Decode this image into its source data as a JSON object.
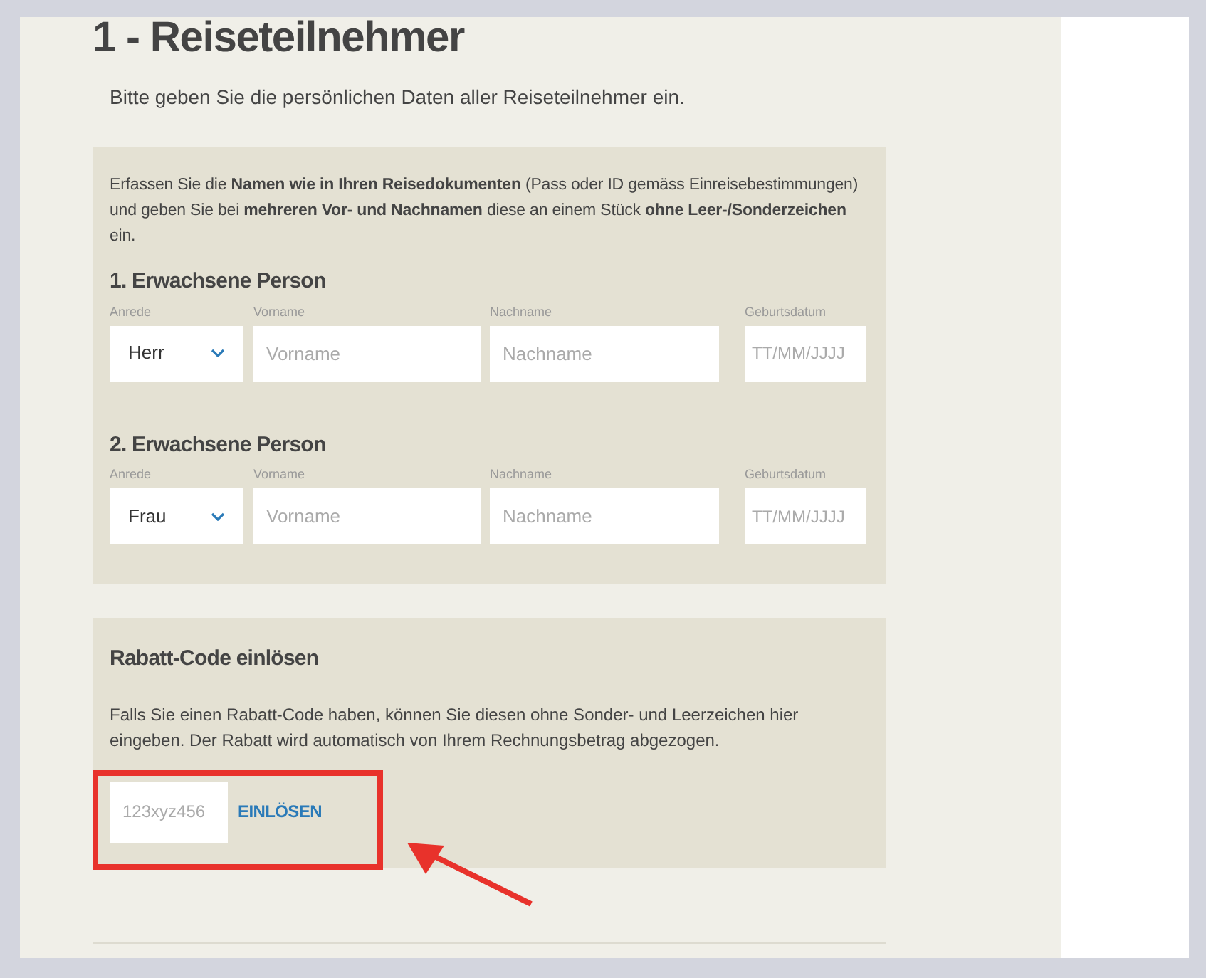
{
  "heading": "1 - Reiseteilnehmer",
  "intro": "Bitte geben Sie die persönlichen Daten aller Reiseteilnehmer ein.",
  "notice": "Erfassen Sie die **Namen wie in Ihren Reisedokumenten** (Pass oder ID gemäss Einreisebestimmungen) und geben Sie bei **mehreren Vor- und Nachnamen** diese an einem Stück **ohne Leer-/Sonderzeichen** ein.",
  "persons": [
    {
      "title": "1. Erwachsene Person",
      "fields": [
        {
          "kind": "select",
          "label": "Anrede",
          "value": "Herr"
        },
        {
          "kind": "input",
          "label": "Vorname",
          "placeholder": "Vorname"
        },
        {
          "kind": "input",
          "label": "Nachname",
          "placeholder": "Nachname"
        },
        {
          "kind": "date",
          "label": "Geburtsdatum",
          "placeholder": "TT/MM/JJJJ"
        }
      ]
    },
    {
      "title": "2. Erwachsene Person",
      "fields": [
        {
          "kind": "select",
          "label": "Anrede",
          "value": "Frau"
        },
        {
          "kind": "input",
          "label": "Vorname",
          "placeholder": "Vorname"
        },
        {
          "kind": "input",
          "label": "Nachname",
          "placeholder": "Nachname"
        },
        {
          "kind": "date",
          "label": "Geburtsdatum",
          "placeholder": "TT/MM/JJJJ"
        }
      ]
    }
  ],
  "discount": {
    "title": "Rabatt-Code einlösen",
    "text": "Falls Sie einen Rabatt-Code haben, können Sie diesen ohne Sonder- und Leerzeichen hier eingeben. Der Rabatt wird automatisch von Ihrem Rechnungsbetrag abgezogen.",
    "placeholder": "123xyz456",
    "button": "EINLÖSEN"
  }
}
